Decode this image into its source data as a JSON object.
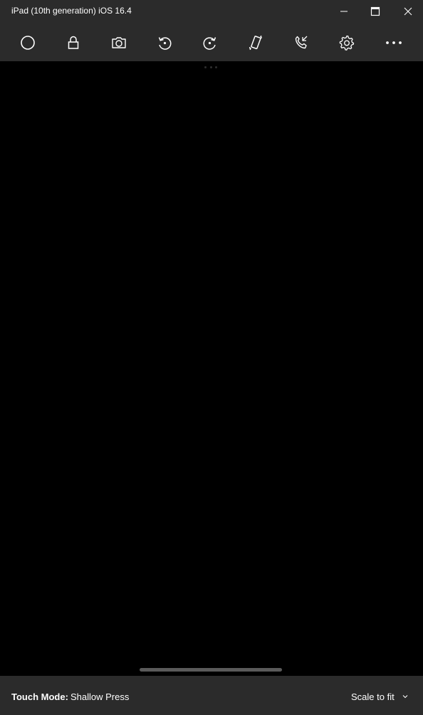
{
  "window": {
    "title": "iPad (10th generation) iOS 16.4",
    "controls": {
      "minimize_icon": "minimize-icon",
      "maximize_icon": "maximize-icon",
      "close_icon": "close-icon"
    }
  },
  "toolbar": {
    "tools": [
      {
        "id": "home",
        "icon": "circle-icon"
      },
      {
        "id": "lock",
        "icon": "lock-icon"
      },
      {
        "id": "screenshot",
        "icon": "camera-icon"
      },
      {
        "id": "rotate-left",
        "icon": "rotate-left-icon"
      },
      {
        "id": "rotate-right",
        "icon": "rotate-right-icon"
      },
      {
        "id": "shake",
        "icon": "shake-device-icon"
      },
      {
        "id": "call",
        "icon": "phone-call-icon"
      },
      {
        "id": "settings",
        "icon": "gear-icon"
      },
      {
        "id": "more",
        "icon": "more-icon"
      }
    ]
  },
  "screen": {
    "background": "#000000"
  },
  "statusbar": {
    "touch_mode_label": "Touch Mode:",
    "touch_mode_value": "Shallow Press",
    "scale_value": "Scale to fit"
  },
  "colors": {
    "chrome": "#2b2b2b",
    "screen": "#000000",
    "text": "#ffffff",
    "home_indicator": "#5a5a5a"
  }
}
